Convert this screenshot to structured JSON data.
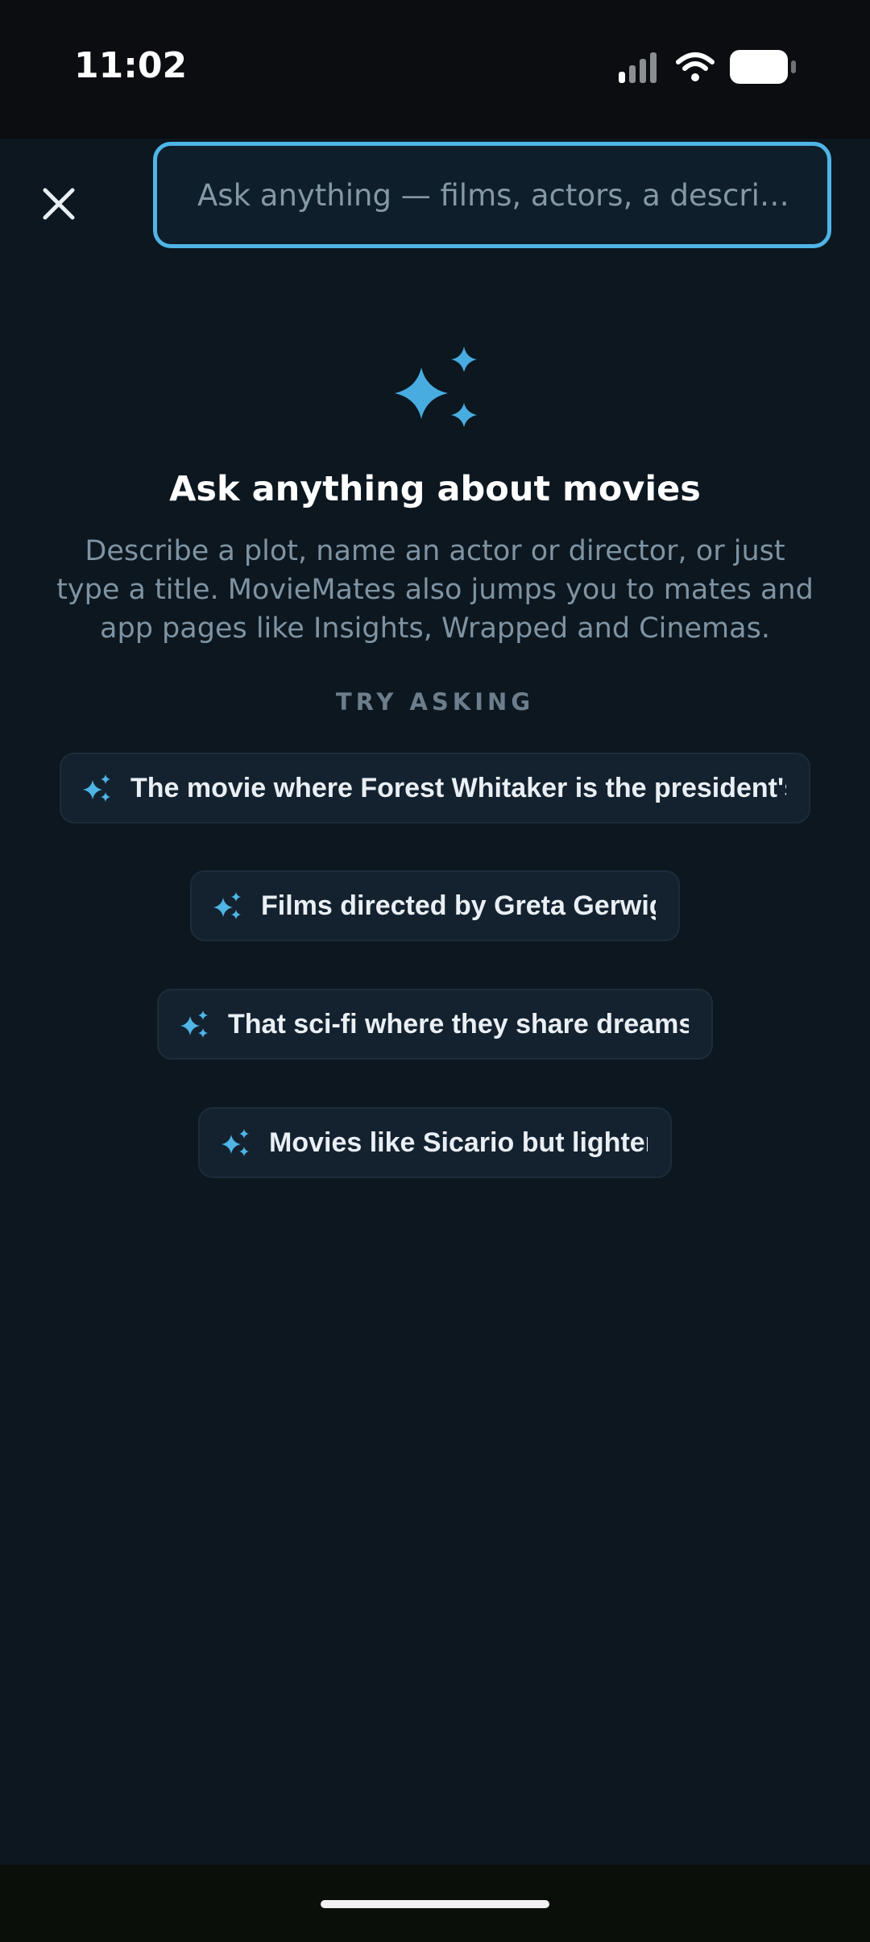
{
  "status_bar": {
    "time": "11:02",
    "icons": [
      "signal-icon",
      "wifi-icon",
      "battery-icon"
    ]
  },
  "search": {
    "placeholder": "Ask anything — films, actors, a descri…",
    "value": ""
  },
  "empty_state": {
    "icon": "sparkles-icon",
    "heading": "Ask anything about movies",
    "description": "Describe a plot, name an actor or director, or just type a title. MovieMates also jumps you to mates and app pages like Insights, Wrapped and Cinemas."
  },
  "suggestions": {
    "label": "TRY ASKING",
    "items": [
      {
        "text": "The movie where Forest Whitaker is the president's"
      },
      {
        "text": "Films directed by Greta Gerwig"
      },
      {
        "text": "That sci-fi where they share dreams"
      },
      {
        "text": "Movies like Sicario but lighter"
      }
    ]
  },
  "colors": {
    "background": "#0c1720",
    "accent": "#4fb5e6",
    "chip_background": "#14222f",
    "muted_text": "#7f93a2"
  }
}
